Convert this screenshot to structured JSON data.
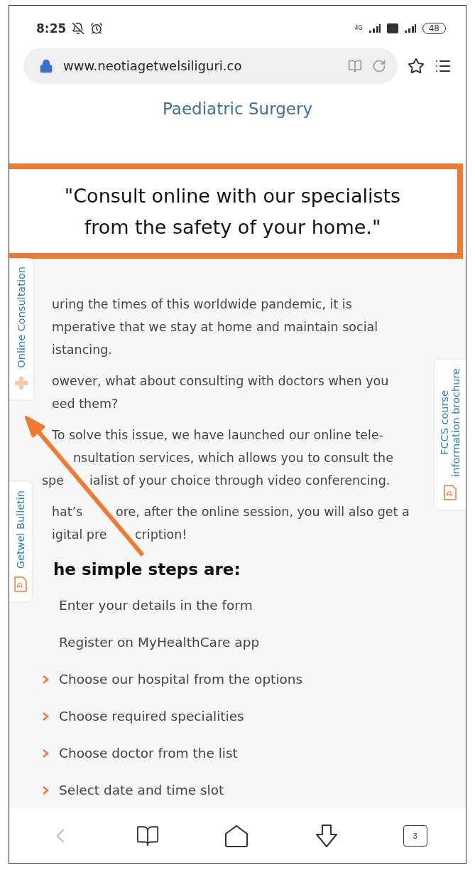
{
  "status_bar": {
    "time": "8:25",
    "network": "4G",
    "battery": "48"
  },
  "address_bar": {
    "url": "www.neotiagetwelsiliguri.co"
  },
  "page_title": "Paediatric Surgery",
  "quote": {
    "lines": [
      "\"Consult online with our specialists",
      "from the safety of your home.\""
    ]
  },
  "paragraphs": [
    {
      "lines": [
        [
          "uring the times of this worldwide pandemic, it is"
        ],
        [
          "mperative that we stay at home and maintain social"
        ],
        [
          "istancing."
        ]
      ]
    },
    {
      "lines": [
        [
          "owever, what about consulting with doctors when you"
        ],
        [
          "eed them?"
        ]
      ]
    },
    {
      "lines": [
        [
          "To solve this issue, we have launched our online tele-"
        ],
        [
          "nsultation services, which allows you to consult the"
        ],
        [
          "spe",
          "ialist of your choice through video conferencing."
        ]
      ]
    },
    {
      "lines": [
        [
          "hat’s",
          "ore, after the online session, you will also get a"
        ],
        [
          "igital pre",
          "cription!"
        ]
      ]
    }
  ],
  "steps_heading": "he simple steps are:",
  "steps": [
    "Enter your details in the form",
    "Register on MyHealthCare app",
    "Choose our hospital from the options",
    "Choose required specialities",
    "Choose doctor from the list",
    "Select date and time slot"
  ],
  "side_tabs": [
    {
      "kind": "left",
      "lines": [
        "Online Consultation"
      ]
    },
    {
      "kind": "left",
      "lines": [
        "Getwel Bulletin"
      ]
    },
    {
      "kind": "right",
      "lines": [
        "FCCS course",
        "information brochure"
      ]
    }
  ],
  "bottom_nav": {
    "tab_count": "3"
  }
}
